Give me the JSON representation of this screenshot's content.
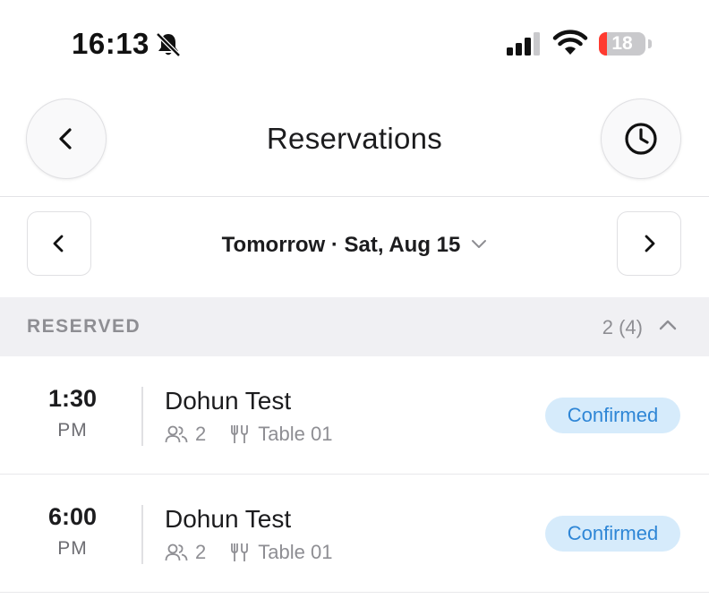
{
  "status_bar": {
    "time": "16:13",
    "battery": "18",
    "battery_level": 0.18
  },
  "header": {
    "title": "Reservations"
  },
  "date_selector": {
    "label": "Tomorrow · Sat, Aug 15"
  },
  "section": {
    "title": "RESERVED",
    "count": "2 (4)"
  },
  "reservations": [
    {
      "time": "1:30",
      "ampm": "PM",
      "name": "Dohun Test",
      "guests": "2",
      "table": "Table 01",
      "status": "Confirmed"
    },
    {
      "time": "6:00",
      "ampm": "PM",
      "name": "Dohun Test",
      "guests": "2",
      "table": "Table 01",
      "status": "Confirmed"
    }
  ],
  "colors": {
    "badge_bg": "#d6ebfb",
    "badge_text": "#2e86d6",
    "battery_low": "#ff3b30"
  }
}
